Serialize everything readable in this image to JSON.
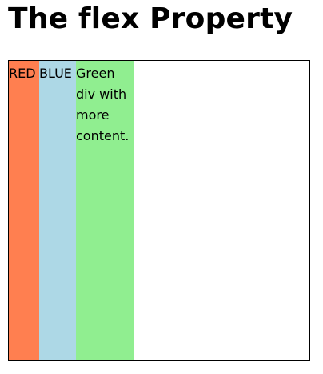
{
  "page": {
    "title": "The flex Property"
  },
  "flex_items": [
    {
      "text": "RED",
      "color": "#ff7f50"
    },
    {
      "text": "BLUE",
      "color": "#add8e6"
    },
    {
      "text": "Green div with more content.",
      "color": "#90ee90"
    }
  ]
}
